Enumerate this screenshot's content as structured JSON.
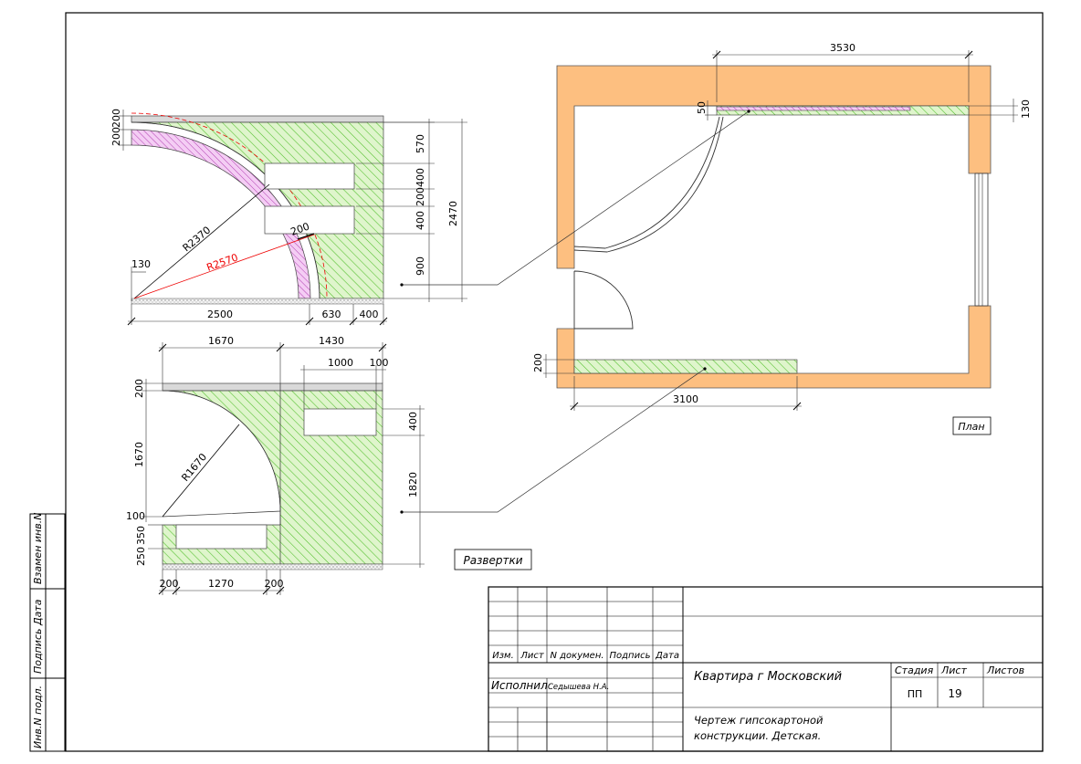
{
  "plan": {
    "dims": {
      "top_width": "3530",
      "bottom_width": "3100",
      "left_gap": "50",
      "right_gap": "130",
      "left_offset": "200"
    },
    "label": "План"
  },
  "elev1": {
    "dims": {
      "top_a": "200",
      "top_b": "200",
      "r_small": "R2370",
      "r_big": "R2570",
      "gap": "200",
      "left": "130",
      "b1": "2500",
      "b2": "630",
      "b3": "400",
      "h1": "570",
      "h2": "400",
      "h3": "200",
      "h4": "400",
      "h5": "900",
      "total": "2470"
    }
  },
  "elev2": {
    "dims": {
      "top_left": "1670",
      "top_right": "1430",
      "w_window": "1000",
      "w_small": "100",
      "h_top": "200",
      "h_main": "1670",
      "radius": "R1670",
      "h_window": "400",
      "total": "1820",
      "l1": "100",
      "l2": "350",
      "l3": "250",
      "b1": "200",
      "b2": "1270",
      "b3": "200"
    }
  },
  "razv_label": "Развертки",
  "stamp": {
    "col_headers": [
      "Изм.",
      "Лист",
      "N докумен.",
      "Подпись",
      "Дата"
    ],
    "executed_label": "Исполнил",
    "executed_name": "Седышева Н.А.",
    "project": "Квартира г Московский",
    "stage_label": "Стадия",
    "sheet_label": "Лист",
    "sheets_label": "Листов",
    "stage_value": "ПП",
    "sheet_value": "19",
    "description_line1": "Чертеж гипсокартоной",
    "description_line2": "конструкции. Детская."
  },
  "side_stamp": {
    "inv_podl": "Инв.N подл.",
    "podpis_data": "Подпись  Дата",
    "vzamen": "Взамен инв.N"
  }
}
